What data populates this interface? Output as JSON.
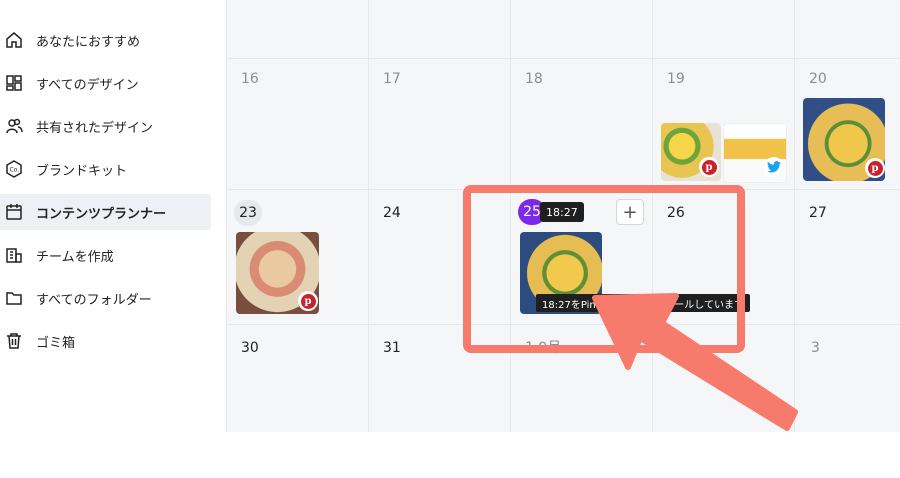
{
  "sidebar": {
    "items": [
      {
        "label": "あなたにおすすめ",
        "icon": "home-icon"
      },
      {
        "label": "すべてのデザイン",
        "icon": "grid-icon"
      },
      {
        "label": "共有されたデザイン",
        "icon": "shared-users-icon"
      },
      {
        "label": "ブランドキット",
        "icon": "brand-kit-icon"
      },
      {
        "label": "コンテンツプランナー",
        "icon": "calendar-icon",
        "active": true
      },
      {
        "label": "チームを作成",
        "icon": "building-icon"
      },
      {
        "label": "すべてのフォルダー",
        "icon": "folder-icon"
      },
      {
        "label": "ゴミ箱",
        "icon": "trash-icon"
      }
    ]
  },
  "calendar": {
    "week2": [
      "16",
      "17",
      "18",
      "19",
      "20"
    ],
    "week3": [
      "23",
      "24",
      "25",
      "26",
      "27"
    ],
    "week4": [
      "30",
      "31",
      "1 9月",
      "",
      "3"
    ],
    "tooltip_time": "18:27",
    "scheduled_label": "18:27をPinterestにスケジュールしています",
    "brand_mark": "Co.",
    "plus_label": "+"
  },
  "colors": {
    "accent": "#7d2ae8",
    "pinterest": "#c8232c",
    "twitter": "#1da1f2",
    "highlight": "#f77b6d"
  }
}
